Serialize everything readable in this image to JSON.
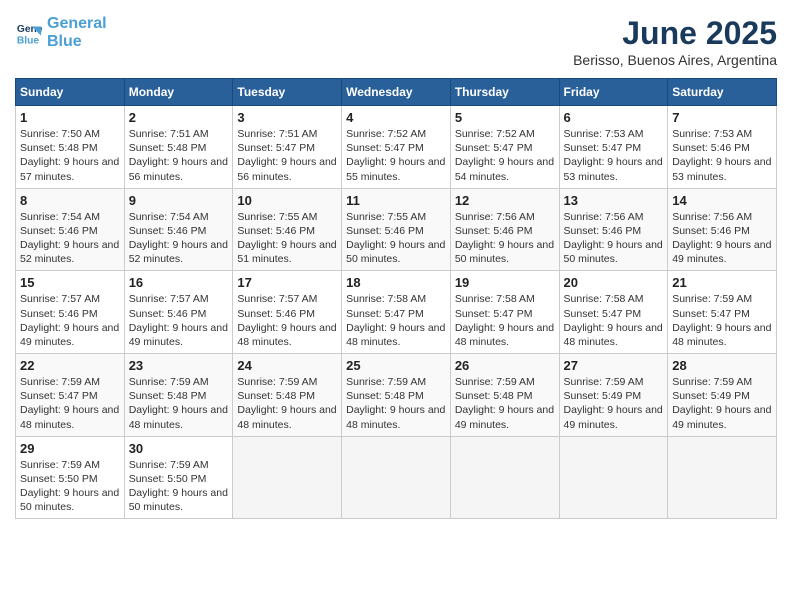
{
  "logo": {
    "line1": "General",
    "line2": "Blue"
  },
  "title": "June 2025",
  "subtitle": "Berisso, Buenos Aires, Argentina",
  "weekdays": [
    "Sunday",
    "Monday",
    "Tuesday",
    "Wednesday",
    "Thursday",
    "Friday",
    "Saturday"
  ],
  "weeks": [
    [
      {
        "day": 1,
        "sunrise": "7:50 AM",
        "sunset": "5:48 PM",
        "daylight": "9 hours and 57 minutes."
      },
      {
        "day": 2,
        "sunrise": "7:51 AM",
        "sunset": "5:48 PM",
        "daylight": "9 hours and 56 minutes."
      },
      {
        "day": 3,
        "sunrise": "7:51 AM",
        "sunset": "5:47 PM",
        "daylight": "9 hours and 56 minutes."
      },
      {
        "day": 4,
        "sunrise": "7:52 AM",
        "sunset": "5:47 PM",
        "daylight": "9 hours and 55 minutes."
      },
      {
        "day": 5,
        "sunrise": "7:52 AM",
        "sunset": "5:47 PM",
        "daylight": "9 hours and 54 minutes."
      },
      {
        "day": 6,
        "sunrise": "7:53 AM",
        "sunset": "5:47 PM",
        "daylight": "9 hours and 53 minutes."
      },
      {
        "day": 7,
        "sunrise": "7:53 AM",
        "sunset": "5:46 PM",
        "daylight": "9 hours and 53 minutes."
      }
    ],
    [
      {
        "day": 8,
        "sunrise": "7:54 AM",
        "sunset": "5:46 PM",
        "daylight": "9 hours and 52 minutes."
      },
      {
        "day": 9,
        "sunrise": "7:54 AM",
        "sunset": "5:46 PM",
        "daylight": "9 hours and 52 minutes."
      },
      {
        "day": 10,
        "sunrise": "7:55 AM",
        "sunset": "5:46 PM",
        "daylight": "9 hours and 51 minutes."
      },
      {
        "day": 11,
        "sunrise": "7:55 AM",
        "sunset": "5:46 PM",
        "daylight": "9 hours and 50 minutes."
      },
      {
        "day": 12,
        "sunrise": "7:56 AM",
        "sunset": "5:46 PM",
        "daylight": "9 hours and 50 minutes."
      },
      {
        "day": 13,
        "sunrise": "7:56 AM",
        "sunset": "5:46 PM",
        "daylight": "9 hours and 50 minutes."
      },
      {
        "day": 14,
        "sunrise": "7:56 AM",
        "sunset": "5:46 PM",
        "daylight": "9 hours and 49 minutes."
      }
    ],
    [
      {
        "day": 15,
        "sunrise": "7:57 AM",
        "sunset": "5:46 PM",
        "daylight": "9 hours and 49 minutes."
      },
      {
        "day": 16,
        "sunrise": "7:57 AM",
        "sunset": "5:46 PM",
        "daylight": "9 hours and 49 minutes."
      },
      {
        "day": 17,
        "sunrise": "7:57 AM",
        "sunset": "5:46 PM",
        "daylight": "9 hours and 48 minutes."
      },
      {
        "day": 18,
        "sunrise": "7:58 AM",
        "sunset": "5:47 PM",
        "daylight": "9 hours and 48 minutes."
      },
      {
        "day": 19,
        "sunrise": "7:58 AM",
        "sunset": "5:47 PM",
        "daylight": "9 hours and 48 minutes."
      },
      {
        "day": 20,
        "sunrise": "7:58 AM",
        "sunset": "5:47 PM",
        "daylight": "9 hours and 48 minutes."
      },
      {
        "day": 21,
        "sunrise": "7:59 AM",
        "sunset": "5:47 PM",
        "daylight": "9 hours and 48 minutes."
      }
    ],
    [
      {
        "day": 22,
        "sunrise": "7:59 AM",
        "sunset": "5:47 PM",
        "daylight": "9 hours and 48 minutes."
      },
      {
        "day": 23,
        "sunrise": "7:59 AM",
        "sunset": "5:48 PM",
        "daylight": "9 hours and 48 minutes."
      },
      {
        "day": 24,
        "sunrise": "7:59 AM",
        "sunset": "5:48 PM",
        "daylight": "9 hours and 48 minutes."
      },
      {
        "day": 25,
        "sunrise": "7:59 AM",
        "sunset": "5:48 PM",
        "daylight": "9 hours and 48 minutes."
      },
      {
        "day": 26,
        "sunrise": "7:59 AM",
        "sunset": "5:48 PM",
        "daylight": "9 hours and 49 minutes."
      },
      {
        "day": 27,
        "sunrise": "7:59 AM",
        "sunset": "5:49 PM",
        "daylight": "9 hours and 49 minutes."
      },
      {
        "day": 28,
        "sunrise": "7:59 AM",
        "sunset": "5:49 PM",
        "daylight": "9 hours and 49 minutes."
      }
    ],
    [
      {
        "day": 29,
        "sunrise": "7:59 AM",
        "sunset": "5:50 PM",
        "daylight": "9 hours and 50 minutes."
      },
      {
        "day": 30,
        "sunrise": "7:59 AM",
        "sunset": "5:50 PM",
        "daylight": "9 hours and 50 minutes."
      },
      null,
      null,
      null,
      null,
      null
    ]
  ]
}
